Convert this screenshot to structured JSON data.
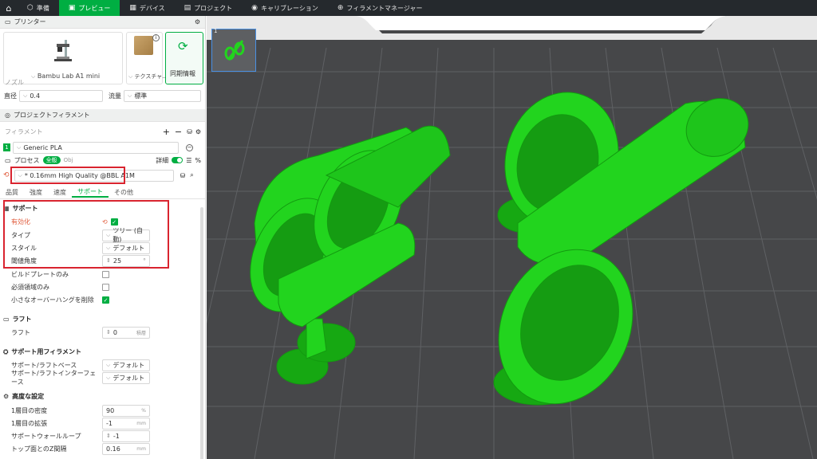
{
  "topbar": {
    "tabs": [
      {
        "label": "準備",
        "icon": "cube-icon",
        "active": false
      },
      {
        "label": "プレビュー",
        "icon": "preview-icon",
        "active": true
      },
      {
        "label": "デバイス",
        "icon": "device-icon",
        "active": false
      },
      {
        "label": "プロジェクト",
        "icon": "project-icon",
        "active": false
      },
      {
        "label": "キャリブレーション",
        "icon": "calibration-icon",
        "active": false
      },
      {
        "label": "フィラメントマネージャー",
        "icon": "filament-manager-icon",
        "active": false
      }
    ]
  },
  "printer": {
    "section_title": "プリンター",
    "name": "Bambu Lab A1 mini",
    "plate": "テクスチャ…",
    "sync_label": "同期情報"
  },
  "nozzle": {
    "section_title": "ノズル",
    "diameter_label": "直径",
    "diameter_value": "0.4",
    "flow_label": "流量",
    "flow_value": "標準"
  },
  "project_filament": {
    "section_title": "プロジェクトフィラメント",
    "filament_label": "フィラメント",
    "slot": "1",
    "filament_name": "Generic PLA"
  },
  "process": {
    "label": "プロセス",
    "toggle_global": "全般",
    "toggle_obj": "Obj",
    "detail_label": "詳細",
    "percent": "%",
    "preset": "* 0.16mm High Quality @BBL A1M",
    "tabs": [
      "品質",
      "強度",
      "速度",
      "サポート",
      "その他"
    ],
    "active_tab": 3
  },
  "support": {
    "title": "サポート",
    "enable_label": "有効化",
    "type_label": "タイプ",
    "type_value": "ツリー (自動)",
    "style_label": "スタイル",
    "style_value": "デフォルト",
    "threshold_label": "閾値角度",
    "threshold_value": "25",
    "threshold_unit": "°",
    "build_plate_only_label": "ビルドプレートのみ",
    "critical_only_label": "必須領域のみ",
    "remove_small_label": "小さなオーバーハングを削除"
  },
  "raft": {
    "title": "ラフト",
    "label": "ラフト",
    "value": "0",
    "unit": "積層"
  },
  "support_filament": {
    "title": "サポート用フィラメント",
    "base_label": "サポート/ラフトベース",
    "base_value": "デフォルト",
    "interface_label": "サポート/ラフトインターフェース",
    "interface_value": "デフォルト"
  },
  "advanced": {
    "title": "高度な設定",
    "rows": [
      {
        "label": "1層目の密度",
        "value": "90",
        "unit": "%"
      },
      {
        "label": "1層目の拡張",
        "value": "-1",
        "unit": "mm"
      },
      {
        "label": "サポートウォールループ",
        "value": "-1",
        "unit": ""
      },
      {
        "label": "トップ面とのZ間隔",
        "value": "0.16",
        "unit": "mm"
      }
    ]
  },
  "viewport": {
    "background": "#464749",
    "model_color": "#1ed41a",
    "bed_label": "1"
  }
}
